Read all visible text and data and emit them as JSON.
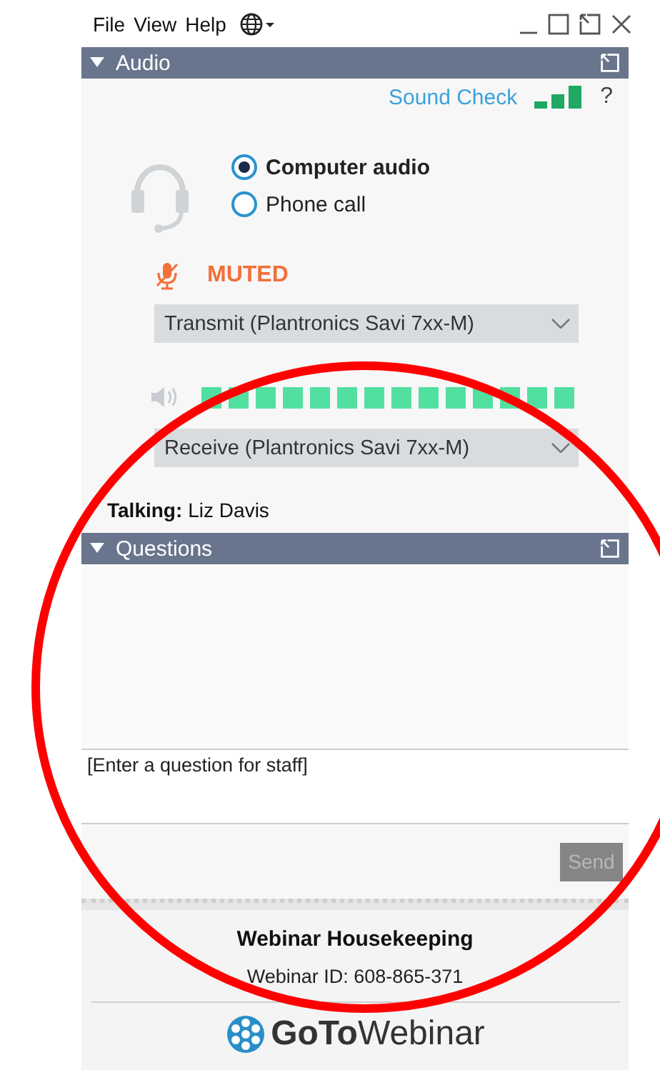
{
  "menu": [
    {
      "label": "File"
    },
    {
      "label": "View"
    },
    {
      "label": "Help"
    }
  ],
  "audio": {
    "title": "Audio",
    "expanded": true,
    "sound_check": "Sound Check",
    "help": "?",
    "options": [
      {
        "label": "Computer audio",
        "selected": true
      },
      {
        "label": "Phone call",
        "selected": false
      }
    ],
    "mute_status": "MUTED",
    "muted": true,
    "transmit": "Transmit (Plantronics Savi 7xx-M)",
    "speaker_meter": {
      "level": 1
    },
    "receive": "Receive (Plantronics Savi 7xx-M)",
    "talking_label": "Talking:",
    "talking_name": "Liz Davis"
  },
  "questions": {
    "title": "Questions",
    "expanded": true,
    "placeholder": "[Enter a question for staff]",
    "send": {
      "label": "Send",
      "disabled": true
    }
  },
  "footer": {
    "title": "Webinar Housekeeping",
    "webinar_id": "Webinar ID: 608-865-371",
    "logo_bold": "GoTo",
    "logo_light": "Webinar"
  }
}
